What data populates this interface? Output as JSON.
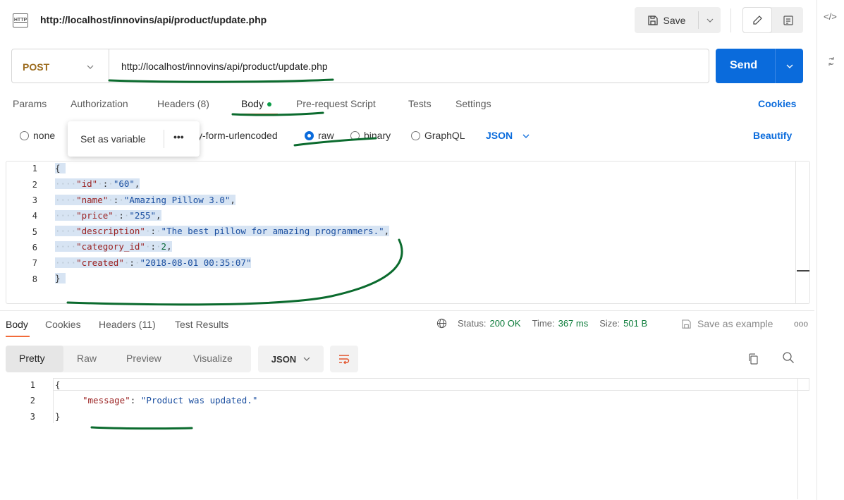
{
  "header": {
    "icon_label": "HTTP",
    "title_url": "http://localhost/innovins/api/product/update.php",
    "save_label": "Save"
  },
  "sidebar_right": {
    "code_icon_label": "</>"
  },
  "request": {
    "method": "POST",
    "url": "http://localhost/innovins/api/product/update.php",
    "send_label": "Send"
  },
  "tabs": {
    "params": "Params",
    "authorization": "Authorization",
    "headers": "Headers (8)",
    "body": "Body",
    "prerequest": "Pre-request Script",
    "tests": "Tests",
    "settings": "Settings",
    "cookies": "Cookies"
  },
  "body_types": {
    "none": "none",
    "urlencoded": "y-form-urlencoded",
    "raw": "raw",
    "binary": "binary",
    "graphql": "GraphQL",
    "format": "JSON",
    "beautify": "Beautify"
  },
  "popup": {
    "label": "Set as variable",
    "more": "•••"
  },
  "request_body": {
    "line_numbers": [
      "1",
      "2",
      "3",
      "4",
      "5",
      "6",
      "7",
      "8"
    ],
    "brace_open": "{",
    "brace_close": "}",
    "fields": [
      {
        "key": "\"id\"",
        "value": "\"60\"",
        "type": "string",
        "comma": ","
      },
      {
        "key": "\"name\"",
        "value": "\"Amazing Pillow 3.0\"",
        "type": "string",
        "comma": ","
      },
      {
        "key": "\"price\"",
        "value": "\"255\"",
        "type": "string",
        "comma": ","
      },
      {
        "key": "\"description\"",
        "value": "\"The best pillow for amazing programmers.\"",
        "type": "string",
        "comma": ","
      },
      {
        "key": "\"category_id\"",
        "value": "2",
        "type": "number",
        "comma": ","
      },
      {
        "key": "\"created\"",
        "value": "\"2018-08-01 00:35:07\"",
        "type": "string",
        "comma": ""
      }
    ]
  },
  "response": {
    "tabs": {
      "body": "Body",
      "cookies": "Cookies",
      "headers": "Headers (11)",
      "test_results": "Test Results"
    },
    "status_label": "Status:",
    "status_value": "200 OK",
    "time_label": "Time:",
    "time_value": "367 ms",
    "size_label": "Size:",
    "size_value": "501 B",
    "save_example": "Save as example",
    "more": "ooo",
    "views": {
      "pretty": "Pretty",
      "raw": "Raw",
      "preview": "Preview",
      "visualize": "Visualize",
      "format": "JSON"
    },
    "line_numbers": [
      "1",
      "2",
      "3"
    ],
    "brace_open": "{",
    "brace_close": "}",
    "message_key": "\"message\"",
    "message_value": "\"Product was updated.\""
  },
  "colors": {
    "accent_blue": "#0a6bdc",
    "method_orange": "#9c6c1f",
    "active_tab_underline": "#f26b3a",
    "status_green": "#0c7c3a",
    "annotation_green": "#0b6b2e"
  },
  "icons": [
    "http-icon",
    "save-icon",
    "chevron-down-icon",
    "pencil-icon",
    "document-icon",
    "code-icon",
    "globe-icon",
    "wrap-lines-icon",
    "copy-icon",
    "search-icon"
  ]
}
